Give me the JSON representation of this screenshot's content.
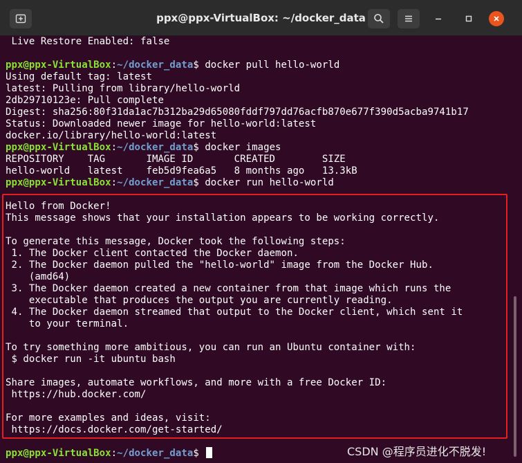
{
  "window": {
    "title": "ppx@ppx-VirtualBox: ~/docker_data",
    "icons": {
      "new_tab": "new-tab-icon",
      "search": "search-icon",
      "menu": "hamburger-menu-icon",
      "minimize": "minimize-icon",
      "maximize": "maximize-icon",
      "close": "close-icon"
    },
    "accent_close": "#e9541f"
  },
  "terminal": {
    "colors": {
      "background": "#300a24",
      "text": "#ffffff",
      "prompt_user": "#8ae234",
      "prompt_path": "#729fcf",
      "highlight_border": "#e51f1f"
    },
    "prompt": {
      "user": "ppx@ppx-VirtualBox",
      "sep": ":",
      "path": "~/docker_data",
      "symbol": "$ "
    },
    "lines": {
      "l1": " Live Restore Enabled: false",
      "cmd_pull": "docker pull hello-world",
      "l3": "Using default tag: latest",
      "l4": "latest: Pulling from library/hello-world",
      "l5": "2db29710123e: Pull complete",
      "l6": "Digest: sha256:80f31da1ac7b312ba29d65080fddf797dd76acfb870e677f390d5acba9741b17",
      "l7": "Status: Downloaded newer image for hello-world:latest",
      "l8": "docker.io/library/hello-world:latest",
      "cmd_images": "docker images",
      "l10": "REPOSITORY    TAG       IMAGE ID       CREATED        SIZE",
      "l11": "hello-world   latest    feb5d9fea6a5   8 months ago   13.3kB",
      "cmd_run": "docker run hello-world",
      "l14": "Hello from Docker!",
      "l15": "This message shows that your installation appears to be working correctly.",
      "l17": "To generate this message, Docker took the following steps:",
      "l18": " 1. The Docker client contacted the Docker daemon.",
      "l19": " 2. The Docker daemon pulled the \"hello-world\" image from the Docker Hub.",
      "l20": "    (amd64)",
      "l21": " 3. The Docker daemon created a new container from that image which runs the",
      "l22": "    executable that produces the output you are currently reading.",
      "l23": " 4. The Docker daemon streamed that output to the Docker client, which sent it",
      "l24": "    to your terminal.",
      "l26": "To try something more ambitious, you can run an Ubuntu container with:",
      "l27": " $ docker run -it ubuntu bash",
      "l29": "Share images, automate workflows, and more with a free Docker ID:",
      "l30": " https://hub.docker.com/",
      "l32": "For more examples and ideas, visit:",
      "l33": " https://docs.docker.com/get-started/"
    }
  },
  "watermark": "CSDN @程序员进化不脱发!"
}
